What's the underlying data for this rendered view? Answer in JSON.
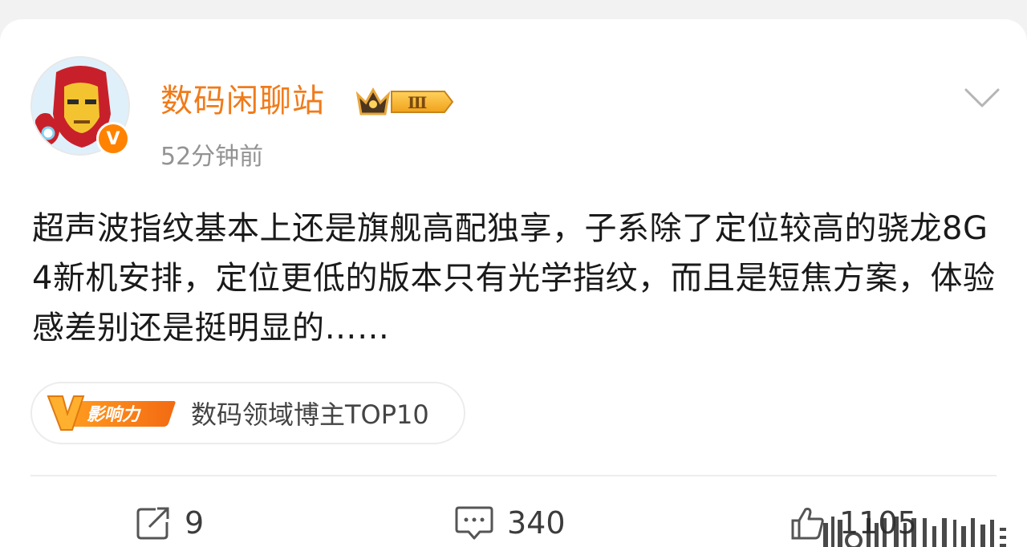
{
  "post": {
    "username": "数码闲聊站",
    "member_level": "Ⅲ",
    "verified_mark": "V",
    "timestamp": "52分钟前",
    "text": "超声波指纹基本上还是旗舰高配独享，子系除了定位较高的骁龙8G4新机安排，定位更低的版本只有光学指纹，而且是短焦方案，体验感差别还是挺明显的……",
    "influence_badge_label": "影响力",
    "influence_tag": "数码领域博主TOP10"
  },
  "actions": {
    "repost_count": "9",
    "comment_count": "340",
    "like_count": "1105"
  },
  "colors": {
    "username": "#f07b1a",
    "accent_orange": "#ff8200",
    "text": "#1a1a1a",
    "muted": "#939393"
  }
}
